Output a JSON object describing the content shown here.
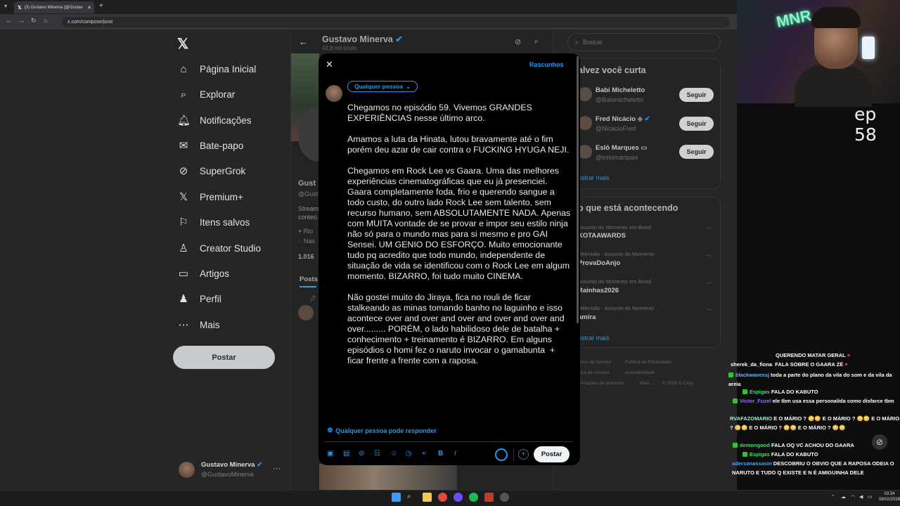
{
  "browser": {
    "tab_title": "(3) Gustavo Minerva (@Gustav",
    "url": "x.com/compose/post"
  },
  "sidebar": {
    "items": [
      {
        "label": "Página Inicial",
        "icon": "home-icon"
      },
      {
        "label": "Explorar",
        "icon": "search-icon"
      },
      {
        "label": "Notificações",
        "icon": "bell-icon"
      },
      {
        "label": "Bate-papo",
        "icon": "mail-icon"
      },
      {
        "label": "SuperGrok",
        "icon": "grok-icon"
      },
      {
        "label": "Premium+",
        "icon": "x-icon"
      },
      {
        "label": "Itens salvos",
        "icon": "bookmark-icon"
      },
      {
        "label": "Creator Studio",
        "icon": "creator-icon"
      },
      {
        "label": "Artigos",
        "icon": "articles-icon"
      },
      {
        "label": "Perfil",
        "icon": "person-icon"
      },
      {
        "label": "Mais",
        "icon": "more-icon"
      }
    ],
    "post_label": "Postar",
    "account": {
      "name": "Gustavo Minerva",
      "handle": "@GustavoMinerva"
    }
  },
  "profile": {
    "name": "Gustavo Minerva",
    "posts_count": "42,8 mil posts",
    "name_fragment": "Gust",
    "handle_fragment": "@Gust",
    "bio_fragment_1": "Stream",
    "bio_fragment_2": "conteú",
    "location_fragment": "Rio",
    "birth_fragment": "Nas",
    "following_fragment": "1.016",
    "tab_posts": "Posts"
  },
  "right": {
    "search_placeholder": "Buscar",
    "who_title": "alvez você curta",
    "who": [
      {
        "name": "Babi Micheletto",
        "handle": "@Babimicheletto",
        "follow": "Seguir"
      },
      {
        "name": "Fred Nicácio",
        "handle": "@NicacioFred",
        "follow": "Seguir"
      },
      {
        "name": "Eslô Marques",
        "handle": "@eslomarques",
        "follow": "Seguir"
      }
    ],
    "show_more": "ostrar mais",
    "trend_title": "o que está acontecendo",
    "trends": [
      {
        "meta": "Assunto do Momento em Brasil",
        "name": "KOTAAWARDS"
      },
      {
        "meta": "Televisão · Assunto do Momento",
        "name": "ProvaDoAnjo"
      },
      {
        "meta": "Assunto do Momento em Brasil",
        "name": "Rainhas2026"
      },
      {
        "meta": "Televisão · Assunto do Momento",
        "name": "amira"
      }
    ],
    "trend_more": "ostrar mais",
    "footer": [
      "rmos de Serviço",
      "Política de Privacidade",
      "ítica de cookies",
      "Acessibilidade",
      "ormações de anúncios",
      "Mais ...",
      "© 2026 X Corp."
    ]
  },
  "modal": {
    "drafts": "Rascunhos",
    "audience": "Qualquer pessoa",
    "paragraphs": [
      "Chegamos no episódio 59. Vivemos GRANDES EXPERIÊNCIAS nesse último arco.",
      "Amamos a luta da Hinata, lutou bravamente até o fim porém deu azar de cair contra o FUCKING HYUGA NEJI.",
      "Chegamos em Rock Lee vs Gaara. Uma das melhores experiências cinematográficas que eu já presenciei. Gaara completamente foda, frio e querendo sangue a todo custo, do outro lado Rock Lee sem talento, sem recurso humano, sem ABSOLUTAMENTE NADA. Apenas com MUITA vontade de se provar e impor seu estilo ninja não só para o mundo mas para si mesmo e pro GAI Sensei. UM GENIO DO ESFORÇO. Muito emocionante tudo pq acredito que todo mundo, independente de situação de vida se identificou com o Rock Lee em algum momento. BIZARRO, foi tudo muito CINEMA.",
      "Não gostei muito do Jiraya, fica no rouli de ficar stalkeando as minas tomando banho no laguinho e isso acontece over and over and over and over and over and over......... PORÉM, o lado habilidoso dele de batalha + conhecimento + treinamento é BIZARRO. Em alguns episódios o homi fez o naruto invocar o gamabunta  + ficar frente a frente com a raposa."
    ],
    "reply_setting": "Qualquer pessoa pode responder",
    "post_label": "Postar"
  },
  "stream": {
    "episode": "ep 58",
    "chat": [
      {
        "user": "",
        "msg": "QUERENDO MATAR GERAL ",
        "color": "#ffffff"
      },
      {
        "user": "sherek_da_fiona",
        "msg": "FALA SOBRE O GAARA ZÉ ",
        "color": "#ffffff"
      },
      {
        "user": "blackwavessj",
        "msg": "toda a parte do plano da vila do som e da vila da areia",
        "color": "#ffffff"
      },
      {
        "user": "Espigas",
        "msg": "FALA DO KABUTO",
        "color": "#3ce06b"
      },
      {
        "user": "Victor_Fuzel",
        "msg": "ele tbm usa essa personalida como disfarce tbm",
        "color": "#9b6bff"
      },
      {
        "user": "RVAFAZOMARIO",
        "msg": "E O MÁRIO ? 😳😳 E O MÁRIO ? 😳😳 E O MÁRIO ? 😳😳 E O MÁRIO ? 😳😳 E O MÁRIO ? 😳😳",
        "color": "#7fffd4"
      },
      {
        "user": "demongood",
        "msg": "FALA OQ VC ACHOU DO GAARA",
        "color": "#3ce06b"
      },
      {
        "user": "Espigas",
        "msg": "FALA DO KABUTO",
        "color": "#3ce06b"
      },
      {
        "user": "adersonassasin",
        "msg": "DESCOBRIU O OBVIO QUE A RAPOSA ODEIA O NARUTO E TUDO Q EXISTE E N É AMIGUINHA DELE",
        "color": "#4aa3ff"
      }
    ]
  },
  "taskbar": {
    "time": "03:34",
    "date": "08/02/2026"
  }
}
